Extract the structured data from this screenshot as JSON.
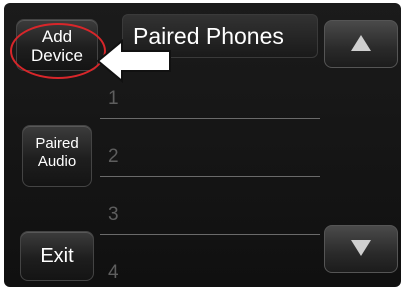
{
  "header": {
    "title": "Paired Phones"
  },
  "buttons": {
    "add_device": [
      "Add",
      "Device"
    ],
    "paired_audio": [
      "Paired",
      "Audio"
    ],
    "exit": "Exit"
  },
  "list": {
    "items": [
      "1",
      "2",
      "3",
      "4"
    ]
  },
  "icons": {
    "scroll_up": "triangle-up-icon",
    "scroll_down": "triangle-down-icon",
    "pointer": "arrow-left-icon"
  },
  "colors": {
    "highlight_circle": "#d8262a",
    "background": "#141414",
    "text": "#ffffff",
    "dim_text": "#5e5e5e"
  }
}
